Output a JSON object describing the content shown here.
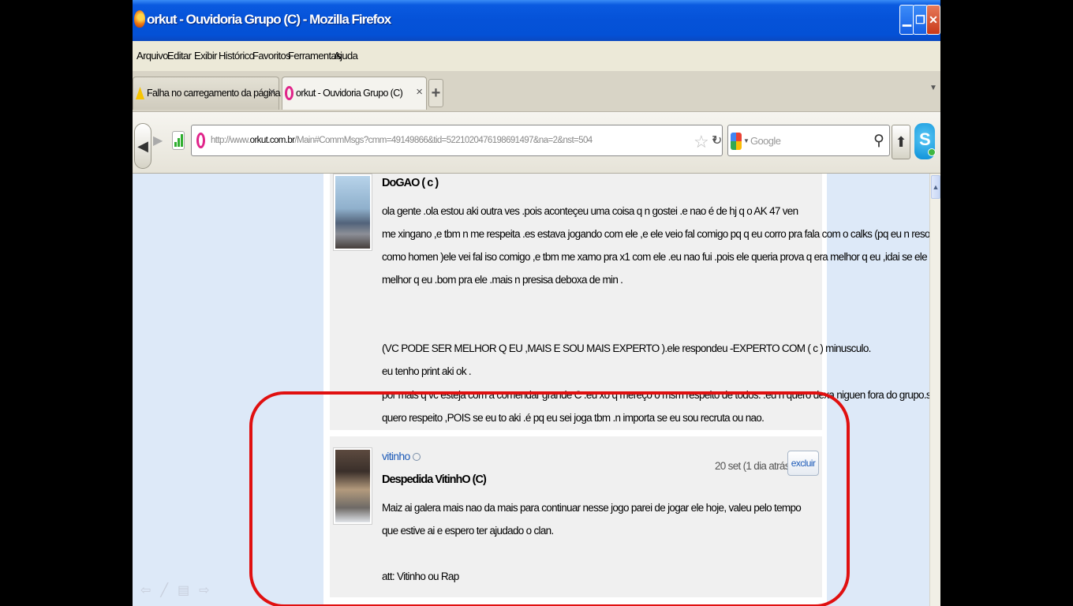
{
  "window": {
    "title": "orkut - Ouvidoria Grupo (C) - Mozilla Firefox"
  },
  "menu": [
    "Arquivo",
    "Editar",
    "Exibir",
    "Histórico",
    "Favoritos",
    "Ferramentas",
    "Ajuda"
  ],
  "tabs": [
    {
      "label": "Falha no carregamento da página",
      "icon": "warning-icon"
    },
    {
      "label": "orkut - Ouvidoria Grupo (C)",
      "icon": "orkut-icon"
    }
  ],
  "nav": {
    "url_prefix": "http://www.",
    "url_domain": "orkut.com.br",
    "url_path": "/Main#CommMsgs?cmm=49149866&tid=5221020476198691497&na=2&nst=504",
    "search_placeholder": "Google"
  },
  "posts": [
    {
      "subject": "DoGAO ( c )",
      "body": [
        "ola gente .ola estou aki outra ves .pois aconteçeu uma coisa q n gostei .e nao é de hj q o AK 47 ven",
        "me xingano ,e tbm n me respeita .es estava jogando com ele ,e ele veio fal comigo pq q eu corro pra fala com o calks (pq eu n resolvo",
        "como homen )ele vei fal iso comigo ,e tbm me xamo pra x1 com ele .eu nao fui .pois ele queria prova q era melhor q eu ,idai se ele é",
        "melhor q eu .bom pra ele .mais n presisa deboxa de min .",
        "",
        "",
        "(VC PODE SER MELHOR Q EU ,MAIS E SOU MAIS EXPERTO ).ele respondeu -EXPERTO COM ( c ) minusculo.",
        "eu tenho print aki ok .",
        "por mais q vc esteja com a comendar grande C .eu xo q mereço o msm respeito de todos. .eu n quero dexa niguen fora do grupo.so",
        "quero respeito ,POIS se eu to aki .é pq eu sei joga tbm .n importa se eu sou recruta ou nao."
      ]
    },
    {
      "author": "vitinho",
      "date": "20 set (1 dia atrás)",
      "delete_label": "excluir",
      "subject": "Despedida VitinhO (C)",
      "body": [
        "Maiz ai galera mais nao da mais para continuar nesse jogo parei de jogar ele hoje, valeu pelo tempo",
        "que estive ai e espero ter ajudado o clan.",
        "",
        "att: Vitinho ou Rap"
      ]
    }
  ],
  "icons": {
    "firefox": "firefox-logo-icon",
    "back": "back-arrow-icon",
    "forward": "forward-arrow-icon",
    "bookmark": "star-icon",
    "reload": "reload-icon",
    "search": "magnifier-icon",
    "home": "home-icon",
    "skype": "skype-icon"
  },
  "colors": {
    "titlebar": "#0552d8",
    "link": "#1e5bb8",
    "highlight_ring": "#e01010",
    "page_bg": "#dde9f8"
  }
}
